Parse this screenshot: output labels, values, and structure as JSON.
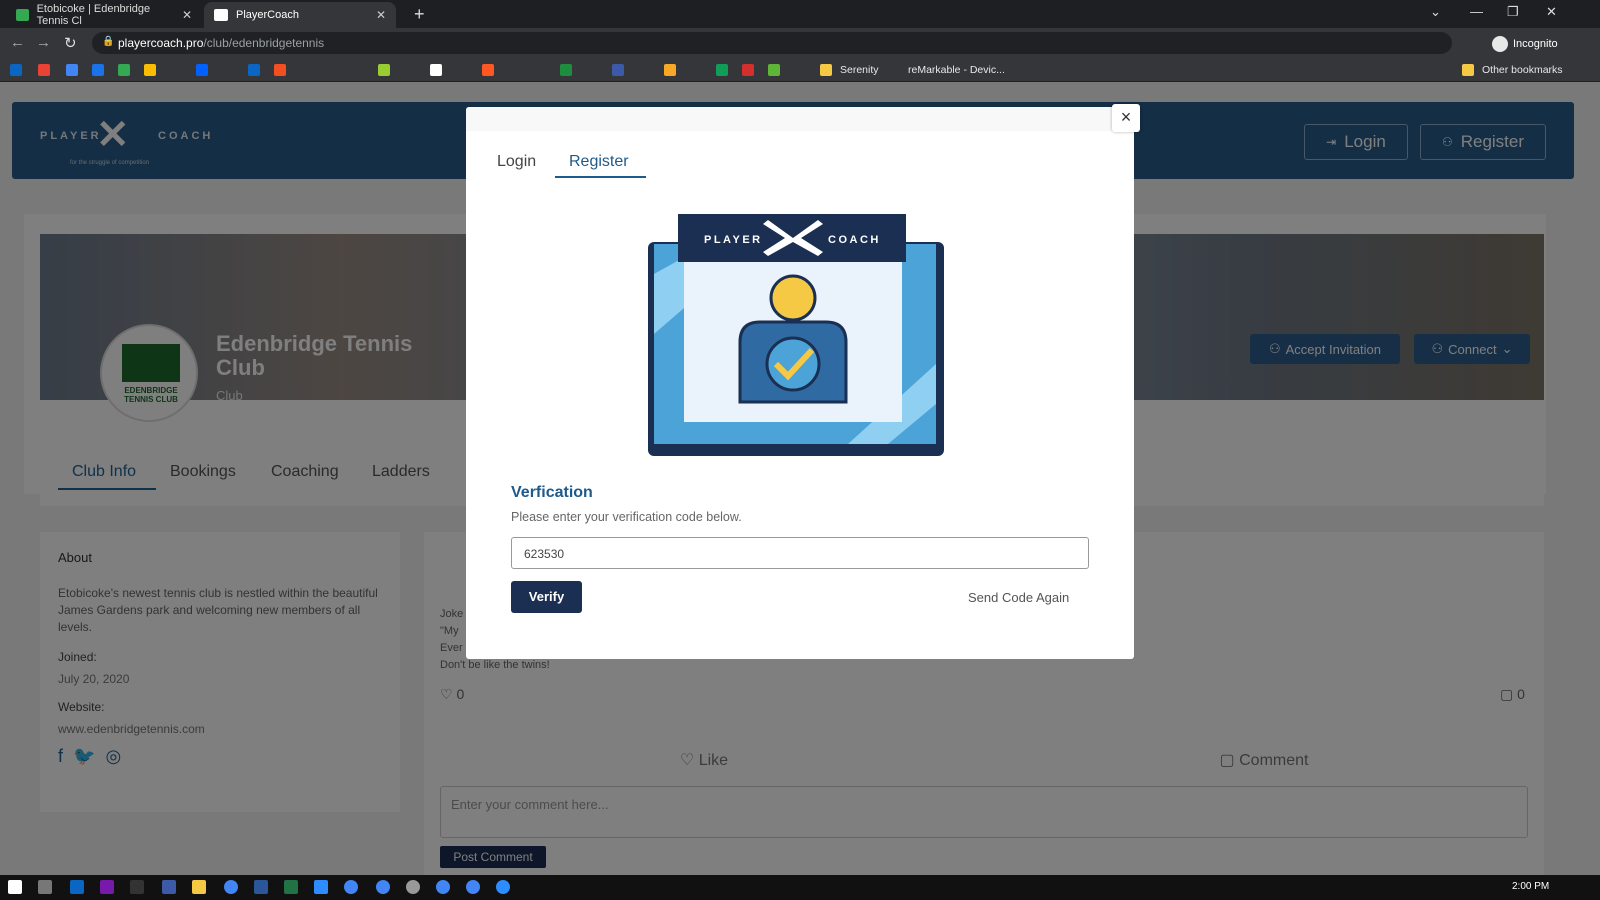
{
  "browser": {
    "tabs": [
      {
        "title": "Etobicoke | Edenbridge Tennis Cl"
      },
      {
        "title": "PlayerCoach"
      }
    ],
    "url_host": "playercoach.pro",
    "url_path": "/club/edenbridgetennis",
    "profile_label": "Incognito",
    "bookmarks": {
      "serenity": "Serenity",
      "remarkable": "reMarkable - Devic...",
      "other": "Other bookmarks"
    }
  },
  "header": {
    "logo_left": "PLAYER",
    "logo_right": "COACH",
    "tagline": "for the struggle of competition",
    "login_label": "Login",
    "register_label": "Register"
  },
  "club": {
    "name": "Edenbridge Tennis Club",
    "type": "Club",
    "logo_text": "EDENBRIDGE TENNIS CLUB",
    "accept_label": "Accept Invitation",
    "connect_label": "Connect"
  },
  "page_tabs": [
    "Club Info",
    "Bookings",
    "Coaching",
    "Ladders"
  ],
  "about": {
    "heading": "About",
    "description": "Etobicoke's newest tennis club is nestled within the beautiful James Gardens park and welcoming new members of all levels.",
    "joined_label": "Joined:",
    "joined_value": "July 20, 2020",
    "website_label": "Website:",
    "website_value": "www.edenbridgetennis.com"
  },
  "feed": {
    "line1": "Joke",
    "line2": "\"My",
    "line3": "Ever",
    "line4": "Don't be like the twins!",
    "likes": "0",
    "comments": "0",
    "like_label": "Like",
    "comment_label": "Comment",
    "comment_placeholder": "Enter your comment here...",
    "post_label": "Post Comment"
  },
  "modal": {
    "tab_login": "Login",
    "tab_register": "Register",
    "badge_left": "PLAYER",
    "badge_right": "COACH",
    "title": "Verfication",
    "subtitle": "Please enter your verification code below.",
    "code_value": "623530",
    "verify_label": "Verify",
    "resend_label": "Send Code Again",
    "close_label": "×"
  },
  "taskbar": {
    "time": "2:00 PM"
  },
  "colors": {
    "brand": "#275d8a",
    "dark_navy": "#1a2f52",
    "accent": "#1e5a8a"
  }
}
